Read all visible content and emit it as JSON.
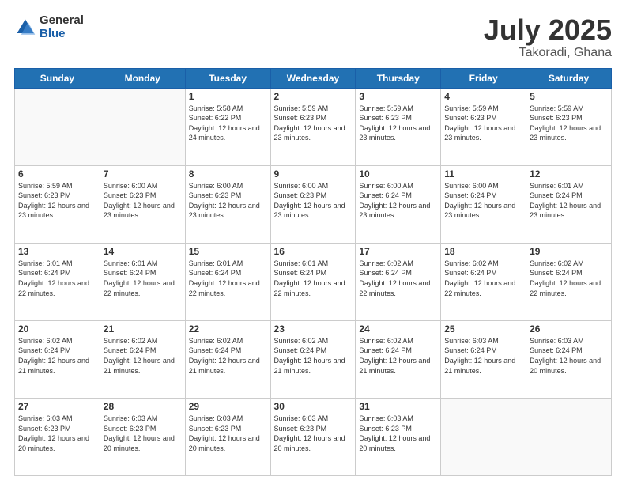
{
  "logo": {
    "general": "General",
    "blue": "Blue"
  },
  "header": {
    "month": "July 2025",
    "location": "Takoradi, Ghana"
  },
  "weekdays": [
    "Sunday",
    "Monday",
    "Tuesday",
    "Wednesday",
    "Thursday",
    "Friday",
    "Saturday"
  ],
  "weeks": [
    [
      {
        "day": "",
        "info": ""
      },
      {
        "day": "",
        "info": ""
      },
      {
        "day": "1",
        "info": "Sunrise: 5:58 AM\nSunset: 6:22 PM\nDaylight: 12 hours and 24 minutes."
      },
      {
        "day": "2",
        "info": "Sunrise: 5:59 AM\nSunset: 6:23 PM\nDaylight: 12 hours and 23 minutes."
      },
      {
        "day": "3",
        "info": "Sunrise: 5:59 AM\nSunset: 6:23 PM\nDaylight: 12 hours and 23 minutes."
      },
      {
        "day": "4",
        "info": "Sunrise: 5:59 AM\nSunset: 6:23 PM\nDaylight: 12 hours and 23 minutes."
      },
      {
        "day": "5",
        "info": "Sunrise: 5:59 AM\nSunset: 6:23 PM\nDaylight: 12 hours and 23 minutes."
      }
    ],
    [
      {
        "day": "6",
        "info": "Sunrise: 5:59 AM\nSunset: 6:23 PM\nDaylight: 12 hours and 23 minutes."
      },
      {
        "day": "7",
        "info": "Sunrise: 6:00 AM\nSunset: 6:23 PM\nDaylight: 12 hours and 23 minutes."
      },
      {
        "day": "8",
        "info": "Sunrise: 6:00 AM\nSunset: 6:23 PM\nDaylight: 12 hours and 23 minutes."
      },
      {
        "day": "9",
        "info": "Sunrise: 6:00 AM\nSunset: 6:23 PM\nDaylight: 12 hours and 23 minutes."
      },
      {
        "day": "10",
        "info": "Sunrise: 6:00 AM\nSunset: 6:24 PM\nDaylight: 12 hours and 23 minutes."
      },
      {
        "day": "11",
        "info": "Sunrise: 6:00 AM\nSunset: 6:24 PM\nDaylight: 12 hours and 23 minutes."
      },
      {
        "day": "12",
        "info": "Sunrise: 6:01 AM\nSunset: 6:24 PM\nDaylight: 12 hours and 23 minutes."
      }
    ],
    [
      {
        "day": "13",
        "info": "Sunrise: 6:01 AM\nSunset: 6:24 PM\nDaylight: 12 hours and 22 minutes."
      },
      {
        "day": "14",
        "info": "Sunrise: 6:01 AM\nSunset: 6:24 PM\nDaylight: 12 hours and 22 minutes."
      },
      {
        "day": "15",
        "info": "Sunrise: 6:01 AM\nSunset: 6:24 PM\nDaylight: 12 hours and 22 minutes."
      },
      {
        "day": "16",
        "info": "Sunrise: 6:01 AM\nSunset: 6:24 PM\nDaylight: 12 hours and 22 minutes."
      },
      {
        "day": "17",
        "info": "Sunrise: 6:02 AM\nSunset: 6:24 PM\nDaylight: 12 hours and 22 minutes."
      },
      {
        "day": "18",
        "info": "Sunrise: 6:02 AM\nSunset: 6:24 PM\nDaylight: 12 hours and 22 minutes."
      },
      {
        "day": "19",
        "info": "Sunrise: 6:02 AM\nSunset: 6:24 PM\nDaylight: 12 hours and 22 minutes."
      }
    ],
    [
      {
        "day": "20",
        "info": "Sunrise: 6:02 AM\nSunset: 6:24 PM\nDaylight: 12 hours and 21 minutes."
      },
      {
        "day": "21",
        "info": "Sunrise: 6:02 AM\nSunset: 6:24 PM\nDaylight: 12 hours and 21 minutes."
      },
      {
        "day": "22",
        "info": "Sunrise: 6:02 AM\nSunset: 6:24 PM\nDaylight: 12 hours and 21 minutes."
      },
      {
        "day": "23",
        "info": "Sunrise: 6:02 AM\nSunset: 6:24 PM\nDaylight: 12 hours and 21 minutes."
      },
      {
        "day": "24",
        "info": "Sunrise: 6:02 AM\nSunset: 6:24 PM\nDaylight: 12 hours and 21 minutes."
      },
      {
        "day": "25",
        "info": "Sunrise: 6:03 AM\nSunset: 6:24 PM\nDaylight: 12 hours and 21 minutes."
      },
      {
        "day": "26",
        "info": "Sunrise: 6:03 AM\nSunset: 6:24 PM\nDaylight: 12 hours and 20 minutes."
      }
    ],
    [
      {
        "day": "27",
        "info": "Sunrise: 6:03 AM\nSunset: 6:23 PM\nDaylight: 12 hours and 20 minutes."
      },
      {
        "day": "28",
        "info": "Sunrise: 6:03 AM\nSunset: 6:23 PM\nDaylight: 12 hours and 20 minutes."
      },
      {
        "day": "29",
        "info": "Sunrise: 6:03 AM\nSunset: 6:23 PM\nDaylight: 12 hours and 20 minutes."
      },
      {
        "day": "30",
        "info": "Sunrise: 6:03 AM\nSunset: 6:23 PM\nDaylight: 12 hours and 20 minutes."
      },
      {
        "day": "31",
        "info": "Sunrise: 6:03 AM\nSunset: 6:23 PM\nDaylight: 12 hours and 20 minutes."
      },
      {
        "day": "",
        "info": ""
      },
      {
        "day": "",
        "info": ""
      }
    ]
  ]
}
